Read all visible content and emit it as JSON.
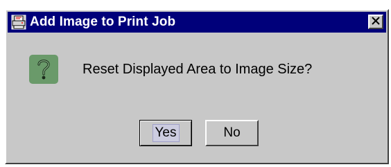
{
  "dialog": {
    "title": "Add Image to Print Job",
    "message": "Reset Displayed Area to Image Size?",
    "icon": "question-icon",
    "close_icon": "close-icon",
    "app_icon": "printer-icon",
    "buttons": {
      "yes_label": "Yes",
      "no_label": "No"
    },
    "colors": {
      "titlebar": "#00007a",
      "background": "#c8c8c8",
      "question_icon_bg": "#6a9a6a"
    }
  }
}
